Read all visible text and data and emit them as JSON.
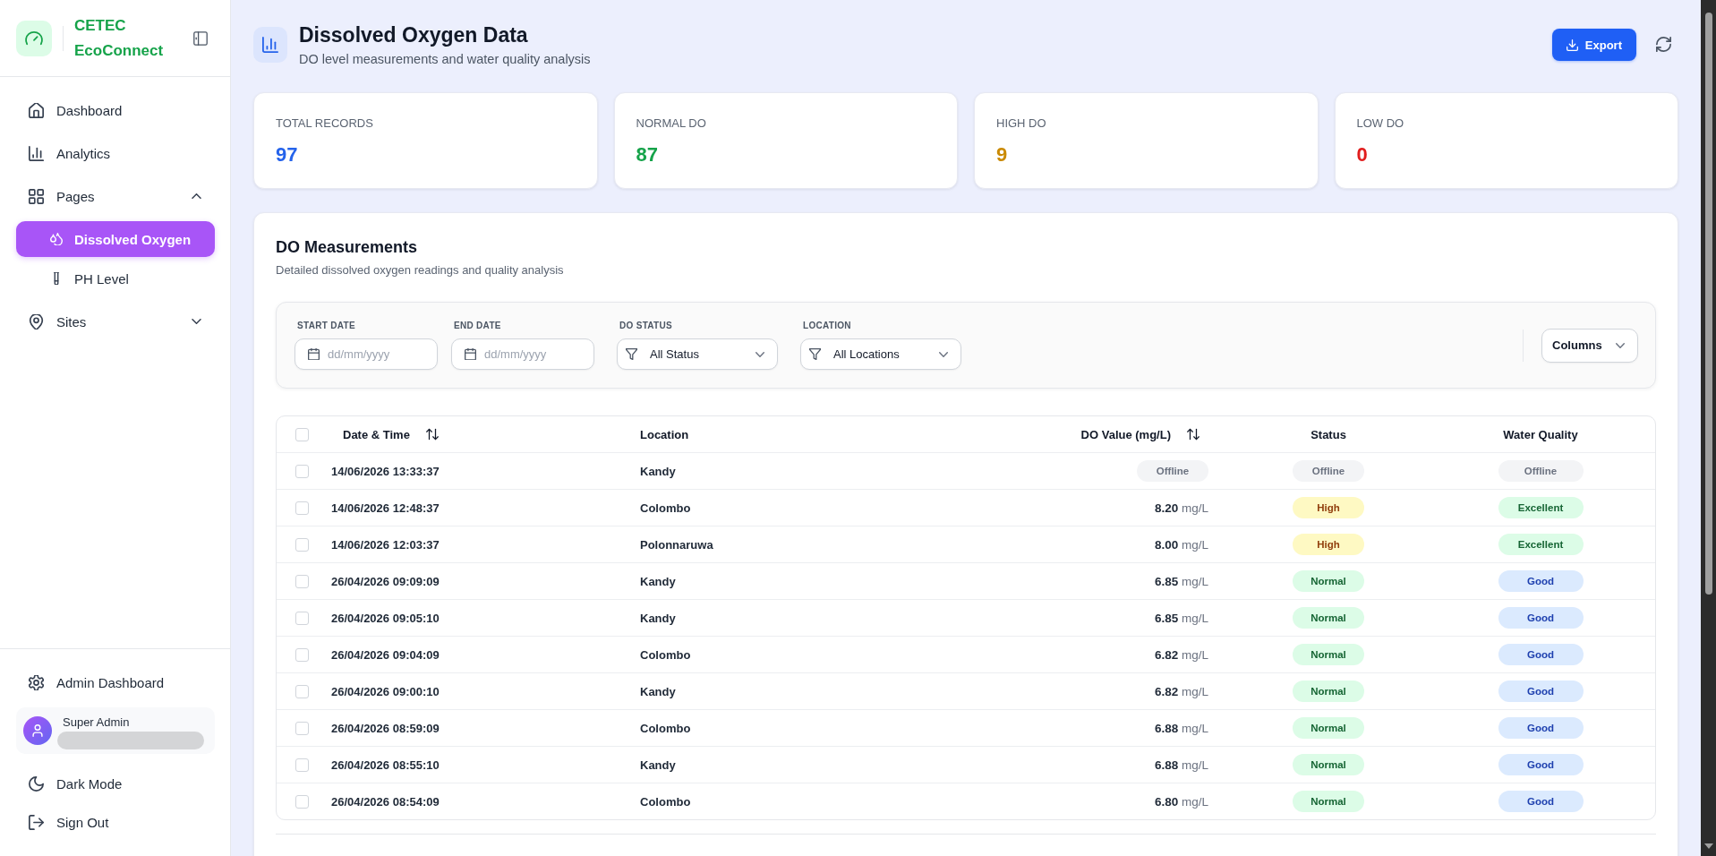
{
  "sidebar": {
    "brand": "CETEC EcoConnect",
    "items": [
      {
        "label": "Dashboard",
        "selected": false
      },
      {
        "label": "Analytics",
        "selected": false
      },
      {
        "label": "Pages",
        "selected": false,
        "expanded": true,
        "children": [
          {
            "label": "Dissolved Oxygen",
            "selected": true
          },
          {
            "label": "PH Level",
            "selected": false
          }
        ]
      },
      {
        "label": "Sites",
        "selected": false,
        "expanded": false
      }
    ],
    "footer": {
      "admin_link": "Admin Dashboard",
      "user": {
        "name": "Super Admin"
      },
      "theme_toggle": "Dark Mode",
      "sign_out": "Sign Out"
    }
  },
  "header": {
    "title": "Dissolved Oxygen Data",
    "subtitle": "DO level measurements and water quality analysis",
    "export_button": "Export"
  },
  "stats": [
    {
      "label": "TOTAL RECORDS",
      "value": "97",
      "color": "#2563eb"
    },
    {
      "label": "NORMAL DO",
      "value": "87",
      "color": "#16a34a"
    },
    {
      "label": "HIGH DO",
      "value": "9",
      "color": "#ca8a04"
    },
    {
      "label": "LOW DO",
      "value": "0",
      "color": "#e11d1d"
    }
  ],
  "measurements": {
    "title": "DO Measurements",
    "subtitle": "Detailed dissolved oxygen readings and quality analysis",
    "filters": [
      {
        "kind": "date",
        "label": "START DATE",
        "placeholder": "dd/mm/yyyy"
      },
      {
        "kind": "date",
        "label": "END DATE",
        "placeholder": "dd/mm/yyyy"
      },
      {
        "kind": "select",
        "label": "DO STATUS",
        "value": "All Status"
      },
      {
        "kind": "select",
        "label": "LOCATION",
        "value": "All Locations"
      }
    ],
    "columns_button": "Columns",
    "table": {
      "select_all_checked": false,
      "columns": [
        {
          "label": "Date & Time",
          "sortable": true
        },
        {
          "label": "Location",
          "sortable": false
        },
        {
          "label": "DO Value (mg/L)",
          "sortable": true
        },
        {
          "label": "Status",
          "sortable": false
        },
        {
          "label": "Water Quality",
          "sortable": false
        }
      ],
      "rows": [
        {
          "checked": false,
          "date_time": "14/06/2026 13:33:37",
          "location": "Kandy",
          "do_value": {
            "kind": "badge",
            "text": "Offline",
            "color": "#f3f4f6"
          },
          "status": {
            "text": "Offline",
            "color": "#f3f4f6"
          },
          "water_quality": {
            "text": "Offline",
            "color": "#f3f4f6"
          }
        },
        {
          "checked": false,
          "date_time": "14/06/2026 12:48:37",
          "location": "Colombo",
          "do_value": {
            "kind": "reading",
            "value": "8.20",
            "unit": "mg/L"
          },
          "status": {
            "text": "High",
            "color": "#fef9c3"
          },
          "water_quality": {
            "text": "Excellent",
            "color": "#dcfce7"
          }
        },
        {
          "checked": false,
          "date_time": "14/06/2026 12:03:37",
          "location": "Polonnaruwa",
          "do_value": {
            "kind": "reading",
            "value": "8.00",
            "unit": "mg/L"
          },
          "status": {
            "text": "High",
            "color": "#fef9c3"
          },
          "water_quality": {
            "text": "Excellent",
            "color": "#dcfce7"
          }
        },
        {
          "checked": false,
          "date_time": "26/04/2026 09:09:09",
          "location": "Kandy",
          "do_value": {
            "kind": "reading",
            "value": "6.85",
            "unit": "mg/L"
          },
          "status": {
            "text": "Normal",
            "color": "#dcfce7"
          },
          "water_quality": {
            "text": "Good",
            "color": "#dbeafe"
          }
        },
        {
          "checked": false,
          "date_time": "26/04/2026 09:05:10",
          "location": "Kandy",
          "do_value": {
            "kind": "reading",
            "value": "6.85",
            "unit": "mg/L"
          },
          "status": {
            "text": "Normal",
            "color": "#dcfce7"
          },
          "water_quality": {
            "text": "Good",
            "color": "#dbeafe"
          }
        },
        {
          "checked": false,
          "date_time": "26/04/2026 09:04:09",
          "location": "Colombo",
          "do_value": {
            "kind": "reading",
            "value": "6.82",
            "unit": "mg/L"
          },
          "status": {
            "text": "Normal",
            "color": "#dcfce7"
          },
          "water_quality": {
            "text": "Good",
            "color": "#dbeafe"
          }
        },
        {
          "checked": false,
          "date_time": "26/04/2026 09:00:10",
          "location": "Kandy",
          "do_value": {
            "kind": "reading",
            "value": "6.82",
            "unit": "mg/L"
          },
          "status": {
            "text": "Normal",
            "color": "#dcfce7"
          },
          "water_quality": {
            "text": "Good",
            "color": "#dbeafe"
          }
        },
        {
          "checked": false,
          "date_time": "26/04/2026 08:59:09",
          "location": "Colombo",
          "do_value": {
            "kind": "reading",
            "value": "6.88",
            "unit": "mg/L"
          },
          "status": {
            "text": "Normal",
            "color": "#dcfce7"
          },
          "water_quality": {
            "text": "Good",
            "color": "#dbeafe"
          }
        },
        {
          "checked": false,
          "date_time": "26/04/2026 08:55:10",
          "location": "Kandy",
          "do_value": {
            "kind": "reading",
            "value": "6.88",
            "unit": "mg/L"
          },
          "status": {
            "text": "Normal",
            "color": "#dcfce7"
          },
          "water_quality": {
            "text": "Good",
            "color": "#dbeafe"
          }
        },
        {
          "checked": false,
          "date_time": "26/04/2026 08:54:09",
          "location": "Colombo",
          "do_value": {
            "kind": "reading",
            "value": "6.80",
            "unit": "mg/L"
          },
          "status": {
            "text": "Normal",
            "color": "#dcfce7"
          },
          "water_quality": {
            "text": "Good",
            "color": "#dbeafe"
          }
        }
      ]
    }
  }
}
